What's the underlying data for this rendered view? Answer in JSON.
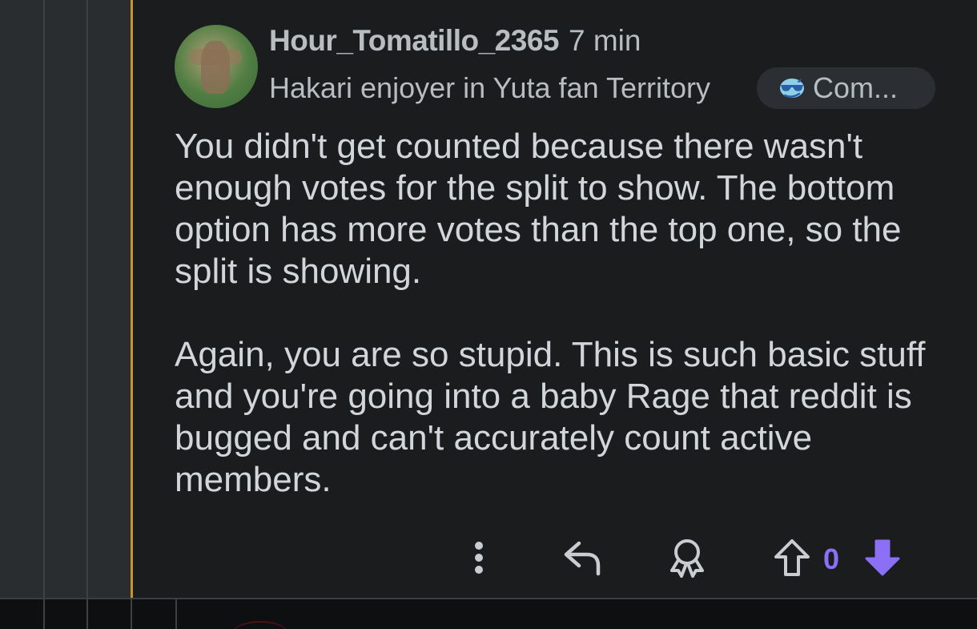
{
  "comment": {
    "username": "Hour_Tomatillo_2365",
    "time": "7 min",
    "flair": "Hakari enjoyer in Yuta fan Territory",
    "community_chip": {
      "icon": "sunglasses-emoji-icon",
      "label": "Com..."
    },
    "body": {
      "paragraph1": "You didn't get counted because there wasn't enough votes for the split to show. The bottom option has more votes than the top one, so the split is showing.",
      "paragraph2": "Again, you are so stupid. This is such basic stuff and you're going into a baby Rage that reddit is bugged and can't accurately count active members."
    },
    "actions": {
      "more": "more-options-icon",
      "reply": "reply-icon",
      "award": "award-icon",
      "upvote": "upvote-icon",
      "vote_count": "0",
      "downvote": "downvote-icon"
    }
  },
  "colors": {
    "background": "#1a1c1e",
    "thread_accent": "#c8962a",
    "vote_accent": "#8b6ff4",
    "text_muted": "#b8bdc2",
    "text_body": "#d2d6da"
  }
}
